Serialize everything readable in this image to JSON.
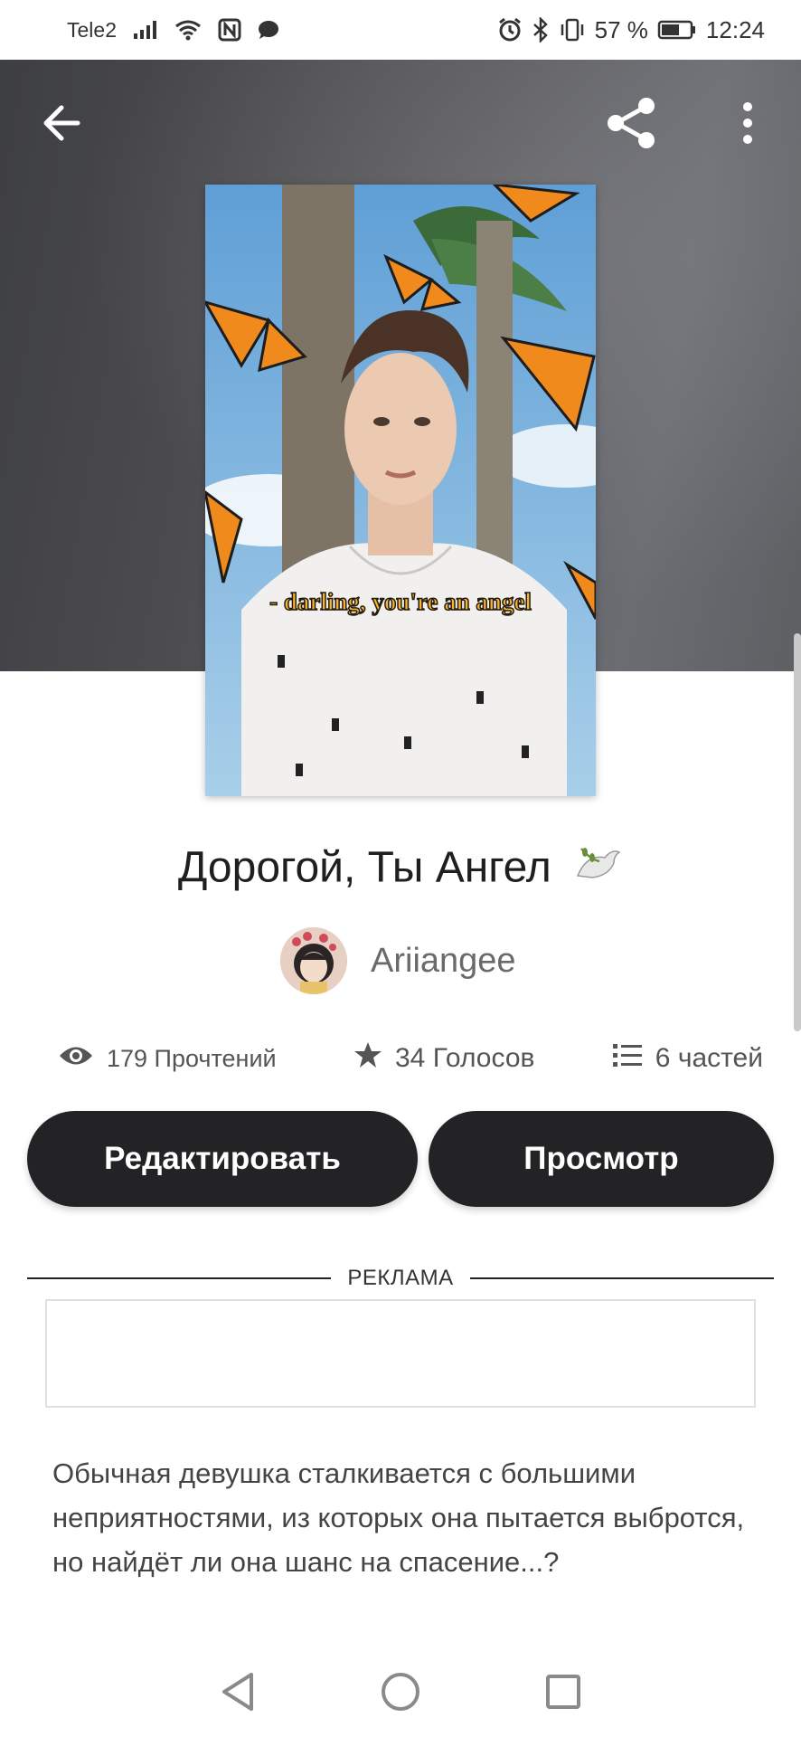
{
  "status_bar": {
    "carrier": "Tele2",
    "battery": "57 %",
    "time": "12:24",
    "icons": [
      "signal-icon",
      "wifi-icon",
      "nfc-icon",
      "message-icon",
      "alarm-icon",
      "bluetooth-icon",
      "vibrate-icon",
      "battery-icon"
    ]
  },
  "header": {
    "back_icon": "arrow-left-icon",
    "share_icon": "share-icon",
    "more_icon": "more-vertical-icon"
  },
  "cover": {
    "caption": "- darling, you're an angel"
  },
  "story": {
    "title": "Дорогой, Ты Ангел",
    "author": "Ariiangee"
  },
  "stats": {
    "reads": "179 Прочтений",
    "votes": "34 Голосов",
    "parts": "6 частей"
  },
  "actions": {
    "edit_label": "Редактировать",
    "view_label": "Просмотр"
  },
  "ad": {
    "label": "РЕКЛАМА"
  },
  "description": "Обычная девушка сталкивается с большими неприятностями, из которых она пытается выбротся, но найдёт ли она шанс на спасение...?",
  "colors": {
    "button_bg": "#232325",
    "button_text": "#ffffff",
    "hero_bg": "#4a4a4d"
  }
}
